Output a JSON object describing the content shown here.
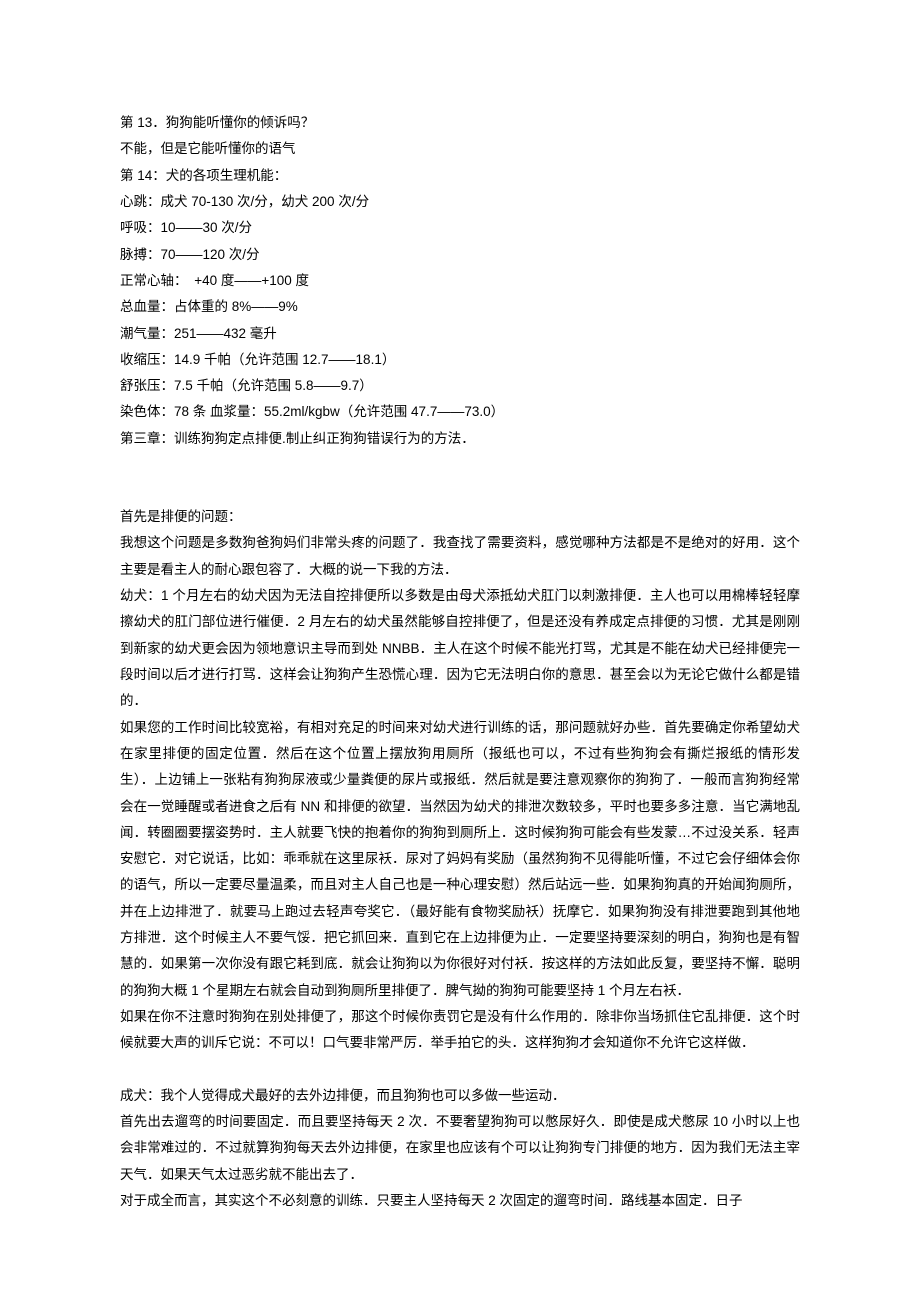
{
  "lines": {
    "l1": "第 13．狗狗能听懂你的倾诉吗？",
    "l2": "不能，但是它能听懂你的语气",
    "l3": "第 14：犬的各项生理机能：",
    "l4": "心跳：成犬 70-130 次/分，幼犬 200 次/分",
    "l5": "呼吸：10——30 次/分",
    "l6": "脉搏：70——120 次/分",
    "l7": "正常心轴：　+40 度——+100 度",
    "l8": "总血量：占体重的 8%——9%",
    "l9": "潮气量：251——432 毫升",
    "l10": "收缩压：14.9 千帕（允许范围 12.7——18.1）",
    "l11": "舒张压：7.5 千帕（允许范围 5.8——9.7）",
    "l12": "染色体：78 条  血浆量：55.2ml/kgbw（允许范围 47.7——73.0）",
    "l13": "第三章：训练狗狗定点排便.制止纠正狗狗错误行为的方法．"
  },
  "section2": {
    "p1": "首先是排便的问题：",
    "p2": "我想这个问题是多数狗爸狗妈们非常头疼的问题了．我查找了需要资料，感觉哪种方法都是不是绝对的好用．这个主要是看主人的耐心跟包容了．大概的说一下我的方法．",
    "p3": "幼犬：1 个月左右的幼犬因为无法自控排便所以多数是由母犬添抵幼犬肛门以刺激排便．主人也可以用棉棒轻轻摩擦幼犬的肛门部位进行催便．2 月左右的幼犬虽然能够自控排便了，但是还没有养成定点排便的习惯．尤其是刚刚到新家的幼犬更会因为领地意识主导而到处 NNBB．主人在这个时候不能光打骂，尤其是不能在幼犬已经排便完一段时间以后才进行打骂．这样会让狗狗产生恐慌心理．因为它无法明白你的意思．甚至会以为无论它做什么都是错的．",
    "p4": "如果您的工作时间比较宽裕，有相对充足的时间来对幼犬进行训练的话，那问题就好办些．首先要确定你希望幼犬在家里排便的固定位置．然后在这个位置上摆放狗用厕所（报纸也可以，不过有些狗狗会有撕烂报纸的情形发生）．上边铺上一张粘有狗狗尿液或少量粪便的尿片或报纸．然后就是要注意观察你的狗狗了．一般而言狗狗经常会在一觉睡醒或者进食之后有 NN 和排便的欲望．当然因为幼犬的排泄次数较多，平时也要多多注意．当它满地乱闻．转圈圈要摆姿势时．主人就要飞快的抱着你的狗狗到厕所上．这时候狗狗可能会有些发蒙…不过没关系．轻声安慰它．对它说话，比如：乖乖就在这里尿袄．尿对了妈妈有奖励（虽然狗狗不见得能听懂，不过它会仔细体会你的语气，所以一定要尽量温柔，而且对主人自己也是一种心理安慰）然后站远一些．如果狗狗真的开始闻狗厕所，并在上边排泄了．就要马上跑过去轻声夸奖它．（最好能有食物奖励袄）抚摩它．如果狗狗没有排泄要跑到其他地方排泄．这个时候主人不要气馁．把它抓回来．直到它在上边排便为止．一定要坚持要深刻的明白，狗狗也是有智慧的．如果第一次你没有跟它耗到底．就会让狗狗以为你很好对付袄．按这样的方法如此反复，要坚持不懈．聪明的狗狗大概 1 个星期左右就会自动到狗厕所里排便了．脾气拗的狗狗可能要坚持 1 个月左右袄．",
    "p5": "如果在你不注意时狗狗在别处排便了，那这个时候你责罚它是没有什么作用的．除非你当场抓住它乱排便．这个时候就要大声的训斥它说：不可以！口气要非常严厉．举手拍它的头．这样狗狗才会知道你不允许它这样做．",
    "p6": "成犬：我个人觉得成犬最好的去外边排便，而且狗狗也可以多做一些运动．",
    "p7": "首先出去遛弯的时间要固定．而且要坚持每天 2 次．不要奢望狗狗可以憋尿好久．即使是成犬憋尿 10 小时以上也会非常难过的．不过就算狗狗每天去外边排便，在家里也应该有个可以让狗狗专门排便的地方．因为我们无法主宰天气．如果天气太过恶劣就不能出去了．",
    "p8": "对于成全而言，其实这个不必刻意的训练．只要主人坚持每天 2 次固定的遛弯时间．路线基本固定．日子"
  }
}
